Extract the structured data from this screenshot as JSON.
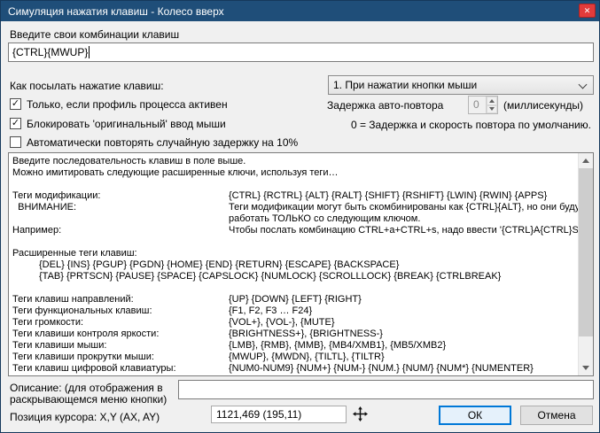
{
  "colors": {
    "titlebar_bg": "#1f4e79",
    "close_button_bg": "#e23b3b",
    "focus_accent": "#0078d7",
    "dialog_bg": "#f0f0f0"
  },
  "window": {
    "title": "Симуляция нажатия клавиш - Колесо вверх"
  },
  "icons": {
    "close": "✕",
    "check": "✓"
  },
  "form": {
    "combo_label": "Введите свои комбинации клавиш",
    "combo_value": "{CTRL}{MWUP}",
    "send_mode_label": "Как посылать нажатие клавиш:",
    "send_mode_value": "1. При нажатии кнопки мыши",
    "checkbox_profile_label": "Только, если профиль процесса активен",
    "checkbox_profile_checked": true,
    "checkbox_block_label": "Блокировать 'оригинальный' ввод мыши",
    "checkbox_block_checked": true,
    "checkbox_random_label": "Автоматически повторять случайную задержку на 10%",
    "checkbox_random_checked": false,
    "delay_label": "Задержка авто-повтора",
    "delay_value": "0",
    "delay_units": "(миллисекунды)",
    "delay_hint": "0 = Задержка и скорость повтора по умолчанию."
  },
  "help": {
    "rows": [
      {
        "full": true,
        "text": "Введите последовательность клавиш в поле выше."
      },
      {
        "full": true,
        "text": "Можно имитировать следующие расширенные ключи, используя теги…"
      },
      {
        "label": "",
        "text": ""
      },
      {
        "label": "Теги модификации:",
        "text": "{CTRL} {RCTRL} {ALT} {RALT} {SHIFT} {RSHIFT} {LWIN} {RWIN} {APPS}"
      },
      {
        "label": "  ВНИМАНИЕ:",
        "text": "Теги модификации могут быть скомбинированы как {CTRL}{ALT}, но они будут"
      },
      {
        "label": "",
        "text": "работать ТОЛЬКО со следующим ключом."
      },
      {
        "label": "Например:",
        "text": "Чтобы послать комбинацию CTRL+a+CTRL+s, надо ввести '{CTRL}A{CTRL}S'."
      },
      {
        "label": "",
        "text": ""
      },
      {
        "full": true,
        "text": "Расширенные теги клавиш:"
      },
      {
        "full": true,
        "indent": true,
        "text": "{DEL} {INS} {PGUP} {PGDN} {HOME} {END} {RETURN} {ESCAPE} {BACKSPACE}"
      },
      {
        "full": true,
        "indent": true,
        "text": "{TAB} {PRTSCN} {PAUSE} {SPACE} {CAPSLOCK} {NUMLOCK} {SCROLLLOCK} {BREAK} {CTRLBREAK}"
      },
      {
        "label": "",
        "text": ""
      },
      {
        "label": "Теги клавиш направлений:",
        "text": "{UP} {DOWN} {LEFT} {RIGHT}"
      },
      {
        "label": "Теги функциональных клавиш:",
        "text": "{F1, F2, F3 … F24}"
      },
      {
        "label": "Теги громкости:",
        "text": "{VOL+}, {VOL-}, {MUTE}"
      },
      {
        "label": "Теги клавиши контроля яркости:",
        "text": "{BRIGHTNESS+}, {BRIGHTNESS-}"
      },
      {
        "label": "Теги клавиши мыши:",
        "text": "{LMB}, {RMB}, {MMB}, {MB4/XMB1}, {MB5/XMB2}"
      },
      {
        "label": "Теги клавиши прокрутки мыши:",
        "text": "{MWUP}, {MWDN}, {TILTL}, {TILTR}"
      },
      {
        "label": "Теги клавиш цифровой клавиатуры:",
        "text": "{NUM0-NUM9} {NUM+} {NUM-} {NUM.} {NUM/} {NUM*} {NUMENTER}"
      }
    ]
  },
  "description": {
    "label": "Описание: (для отображения в раскрывающемся меню кнопки)",
    "value": ""
  },
  "cursor_position": {
    "label": "Позиция курсора: X,Y (AX, AY)",
    "value": "1121,469 (195,11)"
  },
  "buttons": {
    "ok_label": "ОК",
    "cancel_label": "Отмена"
  }
}
